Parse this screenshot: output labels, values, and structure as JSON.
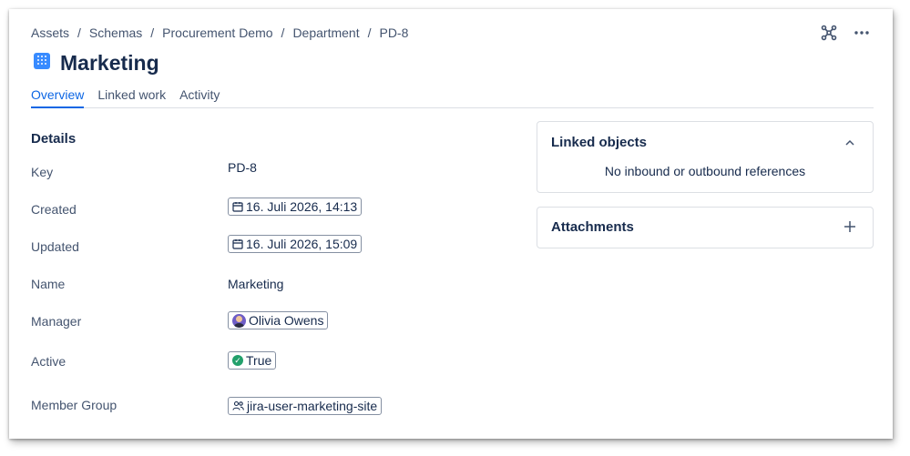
{
  "breadcrumb": [
    "Assets",
    "Schemas",
    "Procurement Demo",
    "Department",
    "PD-8"
  ],
  "breadcrumb_separator": "/",
  "header": {
    "graph_icon": "graph-icon",
    "more_icon": "more-icon",
    "object_icon": "object-type-icon",
    "title": "Marketing"
  },
  "tabs": [
    {
      "label": "Overview",
      "active": true
    },
    {
      "label": "Linked work",
      "active": false
    },
    {
      "label": "Activity",
      "active": false
    }
  ],
  "details": {
    "title": "Details",
    "rows": {
      "key": {
        "label": "Key",
        "value": "PD-8"
      },
      "created": {
        "label": "Created",
        "value": "16. Juli 2026, 14:13",
        "icon": "calendar-icon"
      },
      "updated": {
        "label": "Updated",
        "value": "16. Juli 2026, 15:09",
        "icon": "calendar-icon"
      },
      "name": {
        "label": "Name",
        "value": "Marketing"
      },
      "manager": {
        "label": "Manager",
        "value": "Olivia Owens",
        "icon": "avatar"
      },
      "active": {
        "label": "Active",
        "value": "True",
        "icon": "check-circle-icon"
      },
      "member_group": {
        "label": "Member Group",
        "value": "jira-user-marketing-site",
        "icon": "group-icon"
      }
    }
  },
  "linked_objects": {
    "title": "Linked objects",
    "empty_text": "No inbound or outbound references",
    "toggle_icon": "chevron-up-icon"
  },
  "attachments": {
    "title": "Attachments",
    "add_icon": "plus-icon"
  },
  "colors": {
    "accent": "#0c66e4",
    "text": "#172b4d",
    "subtle_text": "#44546f",
    "border": "#dcdfe4",
    "success": "#22a06b",
    "object_icon": "#388bff"
  }
}
